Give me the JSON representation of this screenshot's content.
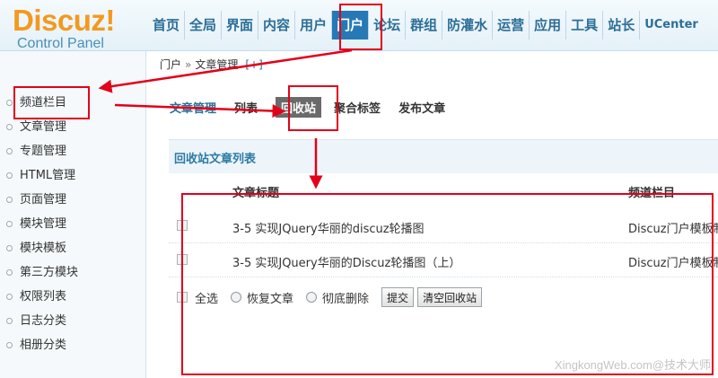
{
  "logo": {
    "name": "Discuz!",
    "subtitle": "Control Panel"
  },
  "topnav": {
    "items": [
      "首页",
      "全局",
      "界面",
      "内容",
      "用户",
      "门户",
      "论坛",
      "群组",
      "防灌水",
      "运营",
      "应用",
      "工具",
      "站长",
      "UCenter"
    ],
    "active": "门户"
  },
  "breadcrumb": {
    "root": "门户",
    "separator": "»",
    "current": "文章管理",
    "add": "[+]"
  },
  "sidebar": {
    "items": [
      "频道栏目",
      "文章管理",
      "专题管理",
      "HTML管理",
      "页面管理",
      "模块管理",
      "模块模板",
      "第三方模块",
      "权限列表",
      "日志分类",
      "相册分类"
    ]
  },
  "subtabs": {
    "items": [
      "文章管理",
      "列表",
      "回收站",
      "聚合标签",
      "发布文章"
    ],
    "current": "回收站"
  },
  "list": {
    "header": "回收站文章列表",
    "columns": {
      "title": "文章标题",
      "category": "频道栏目"
    },
    "rows": [
      {
        "title": "3-5 实现JQuery华丽的discuz轮播图",
        "category": "Discuz门户模板制作"
      },
      {
        "title": "3-5 实现JQuery华丽的Discuz轮播图（上）",
        "category": "Discuz门户模板制作"
      }
    ]
  },
  "actions": {
    "select_all": "全选",
    "restore": "恢复文章",
    "delete": "彻底删除",
    "submit": "提交",
    "empty": "清空回收站"
  },
  "watermark": "XingkongWeb.com@技术大师",
  "colors": {
    "annotation": "#e3001a",
    "nav_active": "#2679b5",
    "logo": "#f29a1f"
  }
}
